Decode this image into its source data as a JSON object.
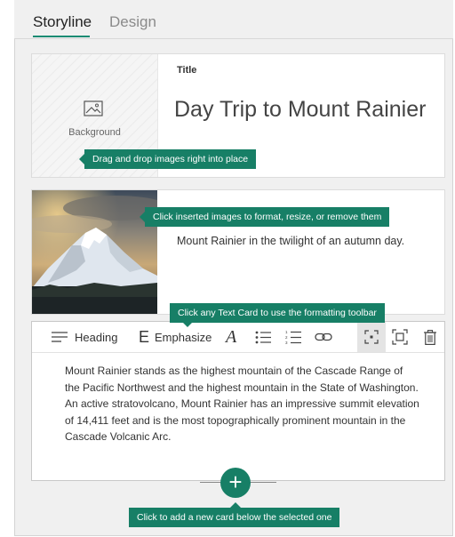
{
  "tabs": {
    "storyline": "Storyline",
    "design": "Design"
  },
  "title_card": {
    "background_label": "Background",
    "title_label": "Title",
    "title_text": "Day Trip to Mount Rainier"
  },
  "image_card": {
    "caption": "Mount Rainier in the twilight of an autumn day."
  },
  "text_card": {
    "toolbar": {
      "heading": "Heading",
      "emphasize": "Emphasize",
      "icons": [
        "heading-icon",
        "emphasize-icon",
        "italic-font-icon",
        "bullet-list-icon",
        "numbered-list-icon",
        "link-icon",
        "focus-frame-icon",
        "frame-icon",
        "trash-icon"
      ]
    },
    "body": "Mount Rainier stands as the highest mountain of the Cascade Range of the Pacific Northwest and the highest mountain in the State of Washington. An active stratovolcano, Mount Rainier has an impressive summit elevation of 14,411 feet and is the most topographically prominent mountain in the Cascade Volcanic Arc."
  },
  "tooltips": {
    "drag_drop": "Drag and drop images right into place",
    "click_images": "Click inserted images to format, resize, or remove them",
    "text_card": "Click any Text Card to use the formatting toolbar",
    "add_card": "Click to add a new card below the selected one"
  },
  "add_button": "+",
  "colors": {
    "accent": "#177f66"
  }
}
